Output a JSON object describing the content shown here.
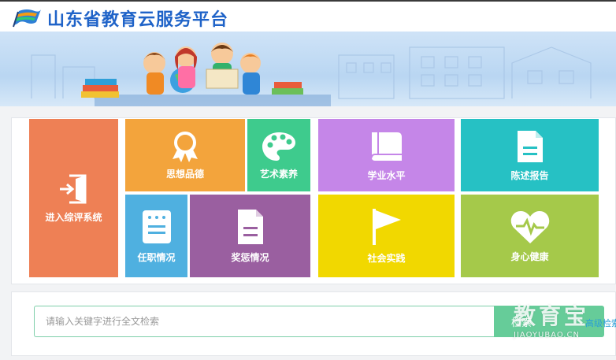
{
  "header": {
    "title": "山东省教育云服务平台",
    "logo_icon": "flag-logo-icon"
  },
  "tiles": [
    {
      "label": "进入综评系统",
      "icon": "door-enter-icon",
      "color": "#ee8055"
    },
    {
      "label": "思想品德",
      "icon": "ribbon-badge-icon",
      "color": "#f3a43c"
    },
    {
      "label": "艺术素养",
      "icon": "palette-icon",
      "color": "#3ecb8d"
    },
    {
      "label": "学业水平",
      "icon": "book-icon",
      "color": "#c586e8"
    },
    {
      "label": "陈述报告",
      "icon": "document-icon",
      "color": "#26c1c4"
    },
    {
      "label": "任职情况",
      "icon": "id-card-icon",
      "color": "#4fb0e0"
    },
    {
      "label": "奖惩情况",
      "icon": "document-icon",
      "color": "#9a5fa0"
    },
    {
      "label": "社会实践",
      "icon": "flag-icon",
      "color": "#f1d800"
    },
    {
      "label": "身心健康",
      "icon": "heart-pulse-icon",
      "color": "#a5c94a"
    }
  ],
  "search": {
    "placeholder": "请输入关键字进行全文检索",
    "button_label": "检索",
    "advanced_label": "高级检索"
  },
  "watermark": {
    "big": "教育宝",
    "small": "JIAOYUBAO.CN"
  }
}
